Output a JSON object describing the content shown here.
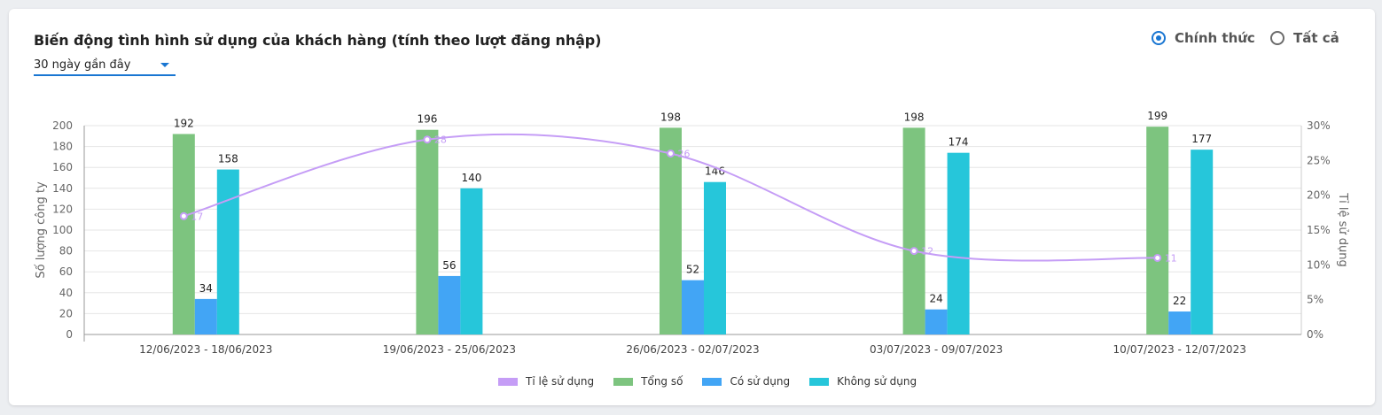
{
  "header": {
    "title": "Biến động tình hình sử dụng của khách hàng (tính theo lượt đăng nhập)",
    "period_select": "30 ngày gần đây"
  },
  "filters": {
    "options": [
      {
        "label": "Chính thức",
        "checked": true
      },
      {
        "label": "Tất cả",
        "checked": false
      }
    ]
  },
  "colors": {
    "rate": "#c59df6",
    "total": "#7dc47f",
    "used": "#42a5f5",
    "unused": "#26c6da"
  },
  "chart_data": {
    "type": "bar",
    "categories": [
      "12/06/2023 - 18/06/2023",
      "19/06/2023 - 25/06/2023",
      "26/06/2023 - 02/07/2023",
      "03/07/2023 - 09/07/2023",
      "10/07/2023 - 12/07/2023"
    ],
    "series": [
      {
        "name": "Tổng số",
        "type": "bar",
        "values": [
          192,
          196,
          198,
          198,
          199
        ]
      },
      {
        "name": "Có sử dụng",
        "type": "bar",
        "values": [
          34,
          56,
          52,
          24,
          22
        ]
      },
      {
        "name": "Không sử dụng",
        "type": "bar",
        "values": [
          158,
          140,
          146,
          174,
          177
        ]
      },
      {
        "name": "Tỉ lệ sử dụng",
        "type": "line",
        "axis": "right",
        "values": [
          17,
          28,
          26,
          12,
          11
        ]
      }
    ],
    "ylabel": "Số lượng công ty",
    "ylabel_right": "Tỉ lệ sử dụng",
    "ylim": [
      0,
      200
    ],
    "ylim_right": [
      0,
      30
    ],
    "yticks": [
      0,
      20,
      40,
      60,
      80,
      100,
      120,
      140,
      160,
      180,
      200
    ],
    "yticks_right": [
      "0%",
      "5%",
      "10%",
      "15%",
      "20%",
      "25%",
      "30%"
    ],
    "legend": [
      "Tỉ lệ sử dụng",
      "Tổng số",
      "Có sử dụng",
      "Không sử dụng"
    ],
    "legend_position": "bottom",
    "grid": true
  }
}
